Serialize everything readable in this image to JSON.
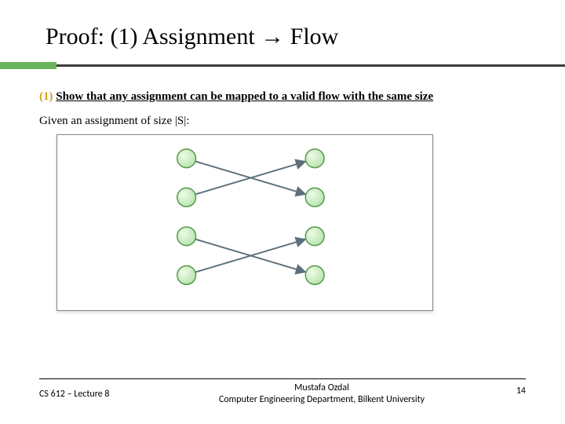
{
  "title": "Proof: (1) Assignment → Flow",
  "step": {
    "num": "(1)",
    "text": "Show that any assignment can be mapped to a valid flow with the same size"
  },
  "given": "Given an assignment of size |S|:",
  "footer": {
    "left": "CS 612 – Lecture 8",
    "center_line1": "Mustafa Ozdal",
    "center_line2": "Computer Engineering Department, Bilkent University",
    "page": "14"
  },
  "colors": {
    "accent": "#6ab45e",
    "gold": "#d0a020",
    "node_fill": "#d5f0cd",
    "node_stroke": "#549a4a",
    "arrow": "#5d6f7a"
  }
}
